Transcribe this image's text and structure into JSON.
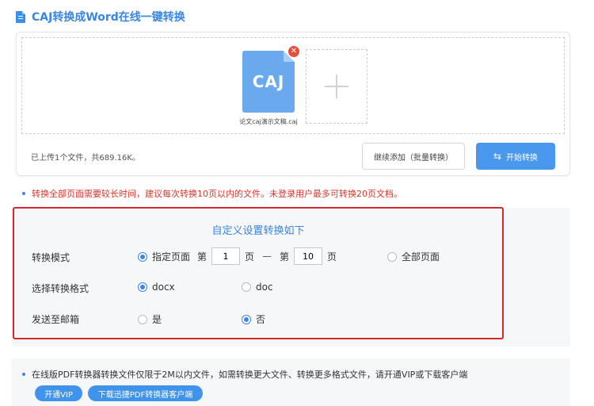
{
  "header": {
    "title": "CAJ转换成Word在线一键转换",
    "icon": "document-icon"
  },
  "upload": {
    "file": {
      "ext_label": "CAJ",
      "name": "论文caj演示文稿.caj"
    },
    "status": "已上传1个文件，共689.16K。",
    "continue_label": "继续添加（批量转换）",
    "start_label": "开始转换",
    "accent_color": "#4a98ee"
  },
  "notice": "转换全部页面需要较长时间，建议每次转换10页以内的文件。未登录用户最多可转换20页文档。",
  "settings": {
    "title": "自定义设置转换如下",
    "mode": {
      "label": "转换模式",
      "specified_label": "指定页面",
      "from_prefix": "第",
      "from_value": "1",
      "from_suffix": "页",
      "dash": "—",
      "to_prefix": "第",
      "to_value": "10",
      "to_suffix": "页",
      "all_label": "全部页面",
      "selected": "specified"
    },
    "format": {
      "label": "选择转换格式",
      "options": [
        "docx",
        "doc"
      ],
      "selected": "docx"
    },
    "email": {
      "label": "发送至邮箱",
      "options": [
        "是",
        "否"
      ],
      "selected": "否"
    }
  },
  "promo": {
    "text": "在线版PDF转换器转换文件仅限于2M以内文件，如需转换更大文件、转换更多格式文件，请开通VIP或下载客户端",
    "vip_label": "开通VIP",
    "download_label": "下载迅捷PDF转换器客户端"
  }
}
